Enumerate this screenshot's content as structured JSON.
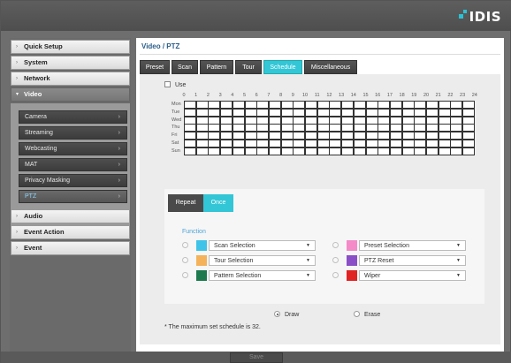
{
  "brand": {
    "logo": "IDIS",
    "accent": "#2bc1d4"
  },
  "sidebar": {
    "menus": [
      {
        "label": "Quick Setup",
        "arrow": "›"
      },
      {
        "label": "System",
        "arrow": "›"
      },
      {
        "label": "Network",
        "arrow": "›"
      },
      {
        "label": "Video",
        "arrow": "▾"
      },
      {
        "label": "Audio",
        "arrow": "›"
      },
      {
        "label": "Event Action",
        "arrow": "›"
      },
      {
        "label": "Event",
        "arrow": "›"
      }
    ],
    "video_submenu": [
      {
        "label": "Camera"
      },
      {
        "label": "Streaming"
      },
      {
        "label": "Webcasting"
      },
      {
        "label": "MAT"
      },
      {
        "label": "Privacy Masking"
      },
      {
        "label": "PTZ"
      }
    ],
    "chevron": "›"
  },
  "main": {
    "title": "Video / PTZ",
    "tabs": [
      "Preset",
      "Scan",
      "Pattern",
      "Tour",
      "Schedule",
      "Miscellaneous"
    ],
    "active_tab": "Schedule",
    "schedule": {
      "use_label": "Use",
      "use_checked": false,
      "hours": [
        "0",
        "1",
        "2",
        "3",
        "4",
        "5",
        "6",
        "7",
        "8",
        "9",
        "10",
        "11",
        "12",
        "13",
        "14",
        "15",
        "16",
        "17",
        "18",
        "19",
        "20",
        "21",
        "22",
        "23",
        "24"
      ],
      "days": [
        "Mon",
        "Tue",
        "Wed",
        "Thu",
        "Fri",
        "Sat",
        "Sun"
      ]
    },
    "function_panel": {
      "subtabs": [
        "Repeat",
        "Once"
      ],
      "active_subtab": "Once",
      "function_label": "Function",
      "left_items": [
        {
          "label": "Scan Selection",
          "color": "#3fc3e8"
        },
        {
          "label": "Tour Selection",
          "color": "#f4b25a"
        },
        {
          "label": "Pattern Selection",
          "color": "#1e7a4e"
        }
      ],
      "right_items": [
        {
          "label": "Preset Selection",
          "color": "#f58ac9"
        },
        {
          "label": "PTZ Reset",
          "color": "#8a4fc7"
        },
        {
          "label": "Wiper",
          "color": "#e02424"
        }
      ],
      "dropdown_icon": "▼"
    },
    "mode": {
      "draw_label": "Draw",
      "erase_label": "Erase",
      "selected": "Draw"
    },
    "note": "* The maximum set schedule is 32."
  },
  "footer": {
    "save_label": "Save"
  }
}
